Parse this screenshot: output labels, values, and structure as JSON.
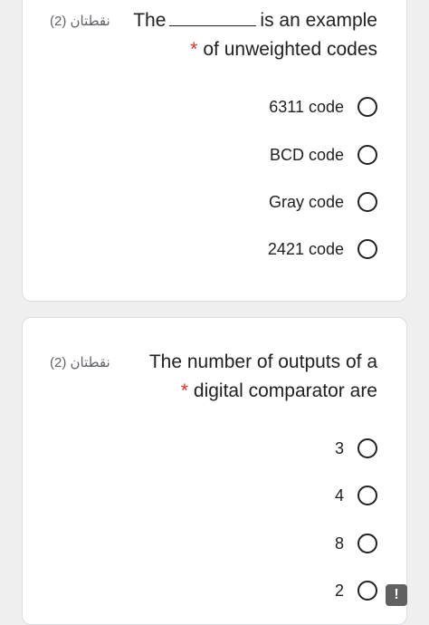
{
  "questions": [
    {
      "points": "نقطتان (2)",
      "text_pre": "The",
      "text_post": "is an example",
      "required_mark": "*",
      "text_line2": "of unweighted codes",
      "options": [
        "6311 code",
        "BCD code",
        "Gray code",
        "2421 code"
      ]
    },
    {
      "points": "نقطتان (2)",
      "text_line1": "The number of outputs of a",
      "required_mark": "*",
      "text_line2": "digital comparator are",
      "options": [
        "3",
        "4",
        "8",
        "2"
      ]
    }
  ],
  "report_button": {
    "glyph": "!",
    "icon": "exclamation-icon",
    "color": "#616161"
  },
  "colors": {
    "required": "#d93025",
    "points": "#5f6368"
  }
}
